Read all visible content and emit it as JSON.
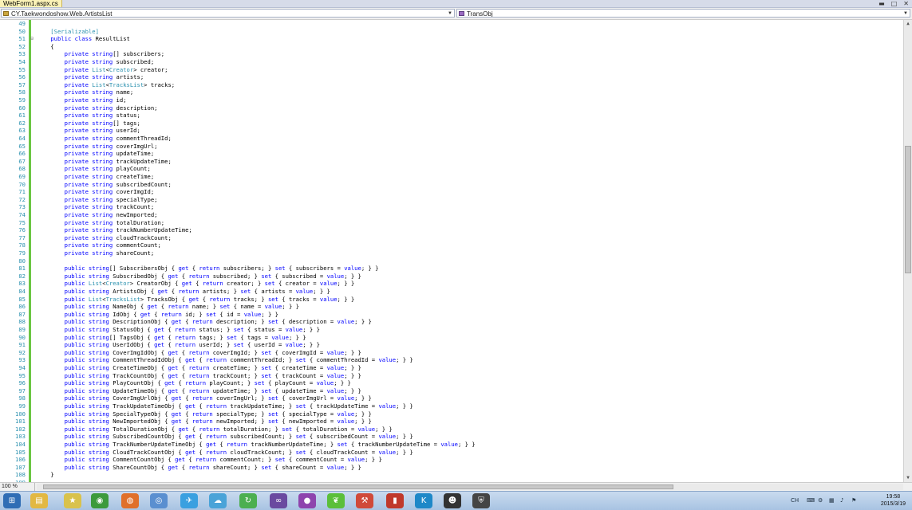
{
  "window": {
    "tab_title": "WebForm1.aspx.cs",
    "min_icon": "minimize-icon",
    "max_icon": "maximize-icon",
    "close_icon": "close-icon",
    "min_glyph": "▬",
    "max_glyph": "□",
    "close_glyph": "✕"
  },
  "navbar": {
    "class_combo": "CY.Taekwondoshow.Web.ArtistsList",
    "member_combo": "TransObj"
  },
  "code": [
    {
      "n": "49",
      "t": ""
    },
    {
      "n": "50",
      "t": "    [Serializable]",
      "hl": "attr"
    },
    {
      "n": "51",
      "t": "    public class ResultList",
      "fold": "⊟"
    },
    {
      "n": "52",
      "t": "    {"
    },
    {
      "n": "53",
      "t": "        private string[] subscribers;"
    },
    {
      "n": "54",
      "t": "        private string subscribed;"
    },
    {
      "n": "55",
      "t": "        private List<Creator> creator;"
    },
    {
      "n": "56",
      "t": "        private string artists;"
    },
    {
      "n": "57",
      "t": "        private List<TracksList> tracks;"
    },
    {
      "n": "58",
      "t": "        private string name;"
    },
    {
      "n": "59",
      "t": "        private string id;"
    },
    {
      "n": "60",
      "t": "        private string description;"
    },
    {
      "n": "61",
      "t": "        private string status;"
    },
    {
      "n": "62",
      "t": "        private string[] tags;"
    },
    {
      "n": "63",
      "t": "        private string userId;"
    },
    {
      "n": "64",
      "t": "        private string commentThreadId;"
    },
    {
      "n": "65",
      "t": "        private string coverImgUrl;"
    },
    {
      "n": "66",
      "t": "        private string updateTime;"
    },
    {
      "n": "67",
      "t": "        private string trackUpdateTime;"
    },
    {
      "n": "68",
      "t": "        private string playCount;"
    },
    {
      "n": "69",
      "t": "        private string createTime;"
    },
    {
      "n": "70",
      "t": "        private string subscribedCount;"
    },
    {
      "n": "71",
      "t": "        private string coverImgId;"
    },
    {
      "n": "72",
      "t": "        private string specialType;"
    },
    {
      "n": "73",
      "t": "        private string trackCount;"
    },
    {
      "n": "74",
      "t": "        private string newImported;"
    },
    {
      "n": "75",
      "t": "        private string totalDuration;"
    },
    {
      "n": "76",
      "t": "        private string trackNumberUpdateTime;"
    },
    {
      "n": "77",
      "t": "        private string cloudTrackCount;"
    },
    {
      "n": "78",
      "t": "        private string commentCount;"
    },
    {
      "n": "79",
      "t": "        private string shareCount;"
    },
    {
      "n": "80",
      "t": ""
    },
    {
      "n": "81",
      "t": "        public string[] SubscribersObj { get { return subscribers; } set { subscribers = value; } }"
    },
    {
      "n": "82",
      "t": "        public string SubscribedObj { get { return subscribed; } set { subscribed = value; } }"
    },
    {
      "n": "83",
      "t": "        public List<Creator> CreatorObj { get { return creator; } set { creator = value; } }"
    },
    {
      "n": "84",
      "t": "        public string ArtistsObj { get { return artists; } set { artists = value; } }"
    },
    {
      "n": "85",
      "t": "        public List<TracksList> TracksObj { get { return tracks; } set { tracks = value; } }"
    },
    {
      "n": "86",
      "t": "        public string NameObj { get { return name; } set { name = value; } }"
    },
    {
      "n": "87",
      "t": "        public string IdObj { get { return id; } set { id = value; } }"
    },
    {
      "n": "88",
      "t": "        public string DescriptionObj { get { return description; } set { description = value; } }"
    },
    {
      "n": "89",
      "t": "        public string StatusObj { get { return status; } set { status = value; } }"
    },
    {
      "n": "90",
      "t": "        public string[] TagsObj { get { return tags; } set { tags = value; } }"
    },
    {
      "n": "91",
      "t": "        public string UserIdObj { get { return userId; } set { userId = value; } }"
    },
    {
      "n": "92",
      "t": "        public string CoverImgIdObj { get { return coverImgId; } set { coverImgId = value; } }"
    },
    {
      "n": "93",
      "t": "        public string CommentThreadIdObj { get { return commentThreadId; } set { commentThreadId = value; } }"
    },
    {
      "n": "94",
      "t": "        public string CreateTimeObj { get { return createTime; } set { createTime = value; } }"
    },
    {
      "n": "95",
      "t": "        public string TrackCountObj { get { return trackCount; } set { trackCount = value; } }"
    },
    {
      "n": "96",
      "t": "        public string PlayCountObj { get { return playCount; } set { playCount = value; } }"
    },
    {
      "n": "97",
      "t": "        public string UpdateTimeObj { get { return updateTime; } set { updateTime = value; } }"
    },
    {
      "n": "98",
      "t": "        public string CoverImgUrlObj { get { return coverImgUrl; } set { coverImgUrl = value; } }"
    },
    {
      "n": "99",
      "t": "        public string TrackUpdateTimeObj { get { return trackUpdateTime; } set { trackUpdateTime = value; } }"
    },
    {
      "n": "100",
      "t": "        public string SpecialTypeObj { get { return specialType; } set { specialType = value; } }"
    },
    {
      "n": "101",
      "t": "        public string NewImportedObj { get { return newImported; } set { newImported = value; } }"
    },
    {
      "n": "102",
      "t": "        public string TotalDurationObj { get { return totalDuration; } set { totalDuration = value; } }"
    },
    {
      "n": "103",
      "t": "        public string SubscribedCountObj { get { return subscribedCount; } set { subscribedCount = value; } }"
    },
    {
      "n": "104",
      "t": "        public string TrackNumberUpdateTimeObj { get { return trackNumberUpdateTime; } set { trackNumberUpdateTime = value; } }"
    },
    {
      "n": "105",
      "t": "        public string CloudTrackCountObj { get { return cloudTrackCount; } set { cloudTrackCount = value; } }"
    },
    {
      "n": "106",
      "t": "        public string CommentCountObj { get { return commentCount; } set { commentCount = value; } }"
    },
    {
      "n": "107",
      "t": "        public string ShareCountObj { get { return shareCount; } set { shareCount = value; } }"
    },
    {
      "n": "108",
      "t": "    }"
    },
    {
      "n": "109",
      "t": ""
    }
  ],
  "statusbar": {
    "zoom": "100 %"
  },
  "taskbar": {
    "icons": [
      {
        "name": "start-orb-icon",
        "color": "#2f6db5",
        "glyph": "⊞"
      },
      {
        "name": "file-explorer-icon",
        "color": "#e2b842",
        "glyph": "▤"
      },
      {
        "name": "app-cat-icon",
        "color": "#d9c24c",
        "glyph": "★"
      },
      {
        "name": "chrome-icon",
        "color": "#3c9a3c",
        "glyph": "◉"
      },
      {
        "name": "firefox-icon",
        "color": "#e0702a",
        "glyph": "◍"
      },
      {
        "name": "browser-globe-icon",
        "color": "#5a8fd0",
        "glyph": "◎"
      },
      {
        "name": "bird-app-icon",
        "color": "#3aa0e0",
        "glyph": "✈"
      },
      {
        "name": "cloud-sync-icon",
        "color": "#4aa3d8",
        "glyph": "☁"
      },
      {
        "name": "green-refresh-icon",
        "color": "#4caf50",
        "glyph": "↻"
      },
      {
        "name": "visual-studio-icon",
        "color": "#6a4aa0",
        "glyph": "∞"
      },
      {
        "name": "purple-orb-icon",
        "color": "#8e44ad",
        "glyph": "●"
      },
      {
        "name": "green-leaf-icon",
        "color": "#5bbf3a",
        "glyph": "❦"
      },
      {
        "name": "red-tool-icon",
        "color": "#d04a3a",
        "glyph": "⚒"
      },
      {
        "name": "red-book-icon",
        "color": "#c0392b",
        "glyph": "▮"
      },
      {
        "name": "k-app-icon",
        "color": "#1e88c8",
        "glyph": "K"
      },
      {
        "name": "qq-penguin-icon",
        "color": "#333333",
        "glyph": "☻"
      },
      {
        "name": "lock-app-icon",
        "color": "#444444",
        "glyph": "⛨"
      }
    ],
    "tray": {
      "lang": "CH",
      "time": "19:58",
      "date": "2015/3/19"
    }
  }
}
